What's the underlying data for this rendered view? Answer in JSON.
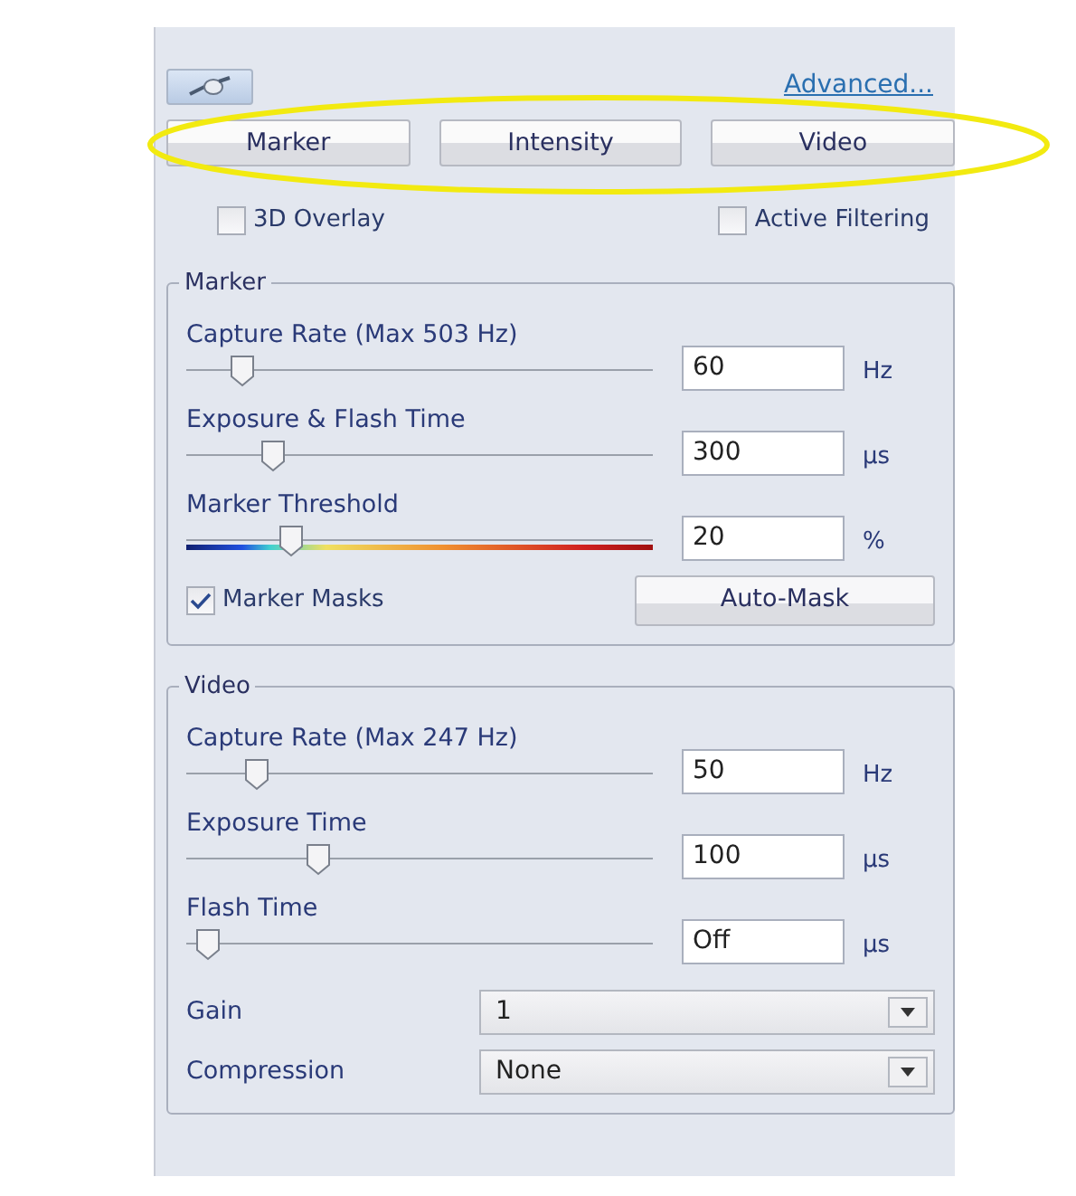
{
  "header": {
    "link": "Advanced..."
  },
  "modes": [
    {
      "label": "Marker"
    },
    {
      "label": "Intensity"
    },
    {
      "label": "Video"
    }
  ],
  "options": [
    {
      "label": "3D Overlay",
      "checked": false
    },
    {
      "label": "Active Filtering",
      "checked": false
    }
  ],
  "groups": [
    {
      "title": "Marker",
      "sliders": [
        {
          "label": "Capture Rate (Max 503 Hz)",
          "kind": "plain",
          "level": 0.1,
          "value": "60",
          "unit": "Hz"
        },
        {
          "label": "Exposure & Flash Time",
          "kind": "plain",
          "level": 0.17,
          "value": "300",
          "unit": "µs"
        },
        {
          "label": "Marker Threshold",
          "kind": "spectrum",
          "level": 0.21,
          "value": "20",
          "unit": "%"
        }
      ],
      "mask": {
        "label": "Marker Masks",
        "checked": true,
        "button": "Auto-Mask"
      }
    },
    {
      "title": "Video",
      "sliders": [
        {
          "label": "Capture Rate (Max 247 Hz)",
          "kind": "plain",
          "level": 0.13,
          "value": "50",
          "unit": "Hz"
        },
        {
          "label": "Exposure Time",
          "kind": "plain",
          "level": 0.27,
          "value": "100",
          "unit": "µs"
        },
        {
          "label": "Flash Time",
          "kind": "plain",
          "level": 0.02,
          "value": "Off",
          "unit": "µs"
        }
      ],
      "selects": [
        {
          "label": "Gain",
          "value": "1"
        },
        {
          "label": "Compression",
          "value": "None"
        }
      ]
    }
  ]
}
